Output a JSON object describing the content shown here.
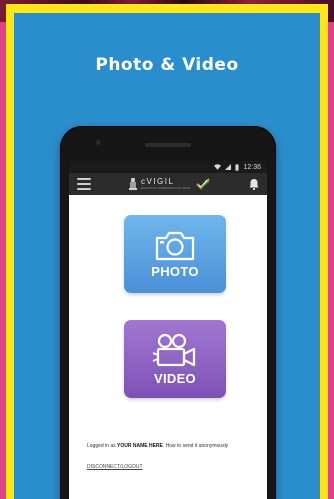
{
  "title": "Photo & Video",
  "status_bar": {
    "time": "12:36"
  },
  "app_bar": {
    "brand_name": "cVIGIL",
    "brand_subtitle": "ELECTION COMMISSION OF INDIA",
    "menu_icon": "hamburger-menu-icon",
    "notification_icon": "bell-icon"
  },
  "tiles": {
    "photo": {
      "label": "PHOTO",
      "icon": "camera-icon",
      "color": "#5aa4e4"
    },
    "video": {
      "label": "VIDEO",
      "icon": "video-camera-icon",
      "color": "#8e63c4"
    }
  },
  "footer": {
    "prefix": "Logged in as",
    "username": "YOUR NAME HERE",
    "suffix": ". How to send it anonymously",
    "logout_label": "DISCONNECT/LOGOUT"
  },
  "colors": {
    "panel_background": "#2b8ecc",
    "frame_border": "#ffe619",
    "edge_accent": "#e0408a",
    "app_bar": "#2c2c2c"
  }
}
